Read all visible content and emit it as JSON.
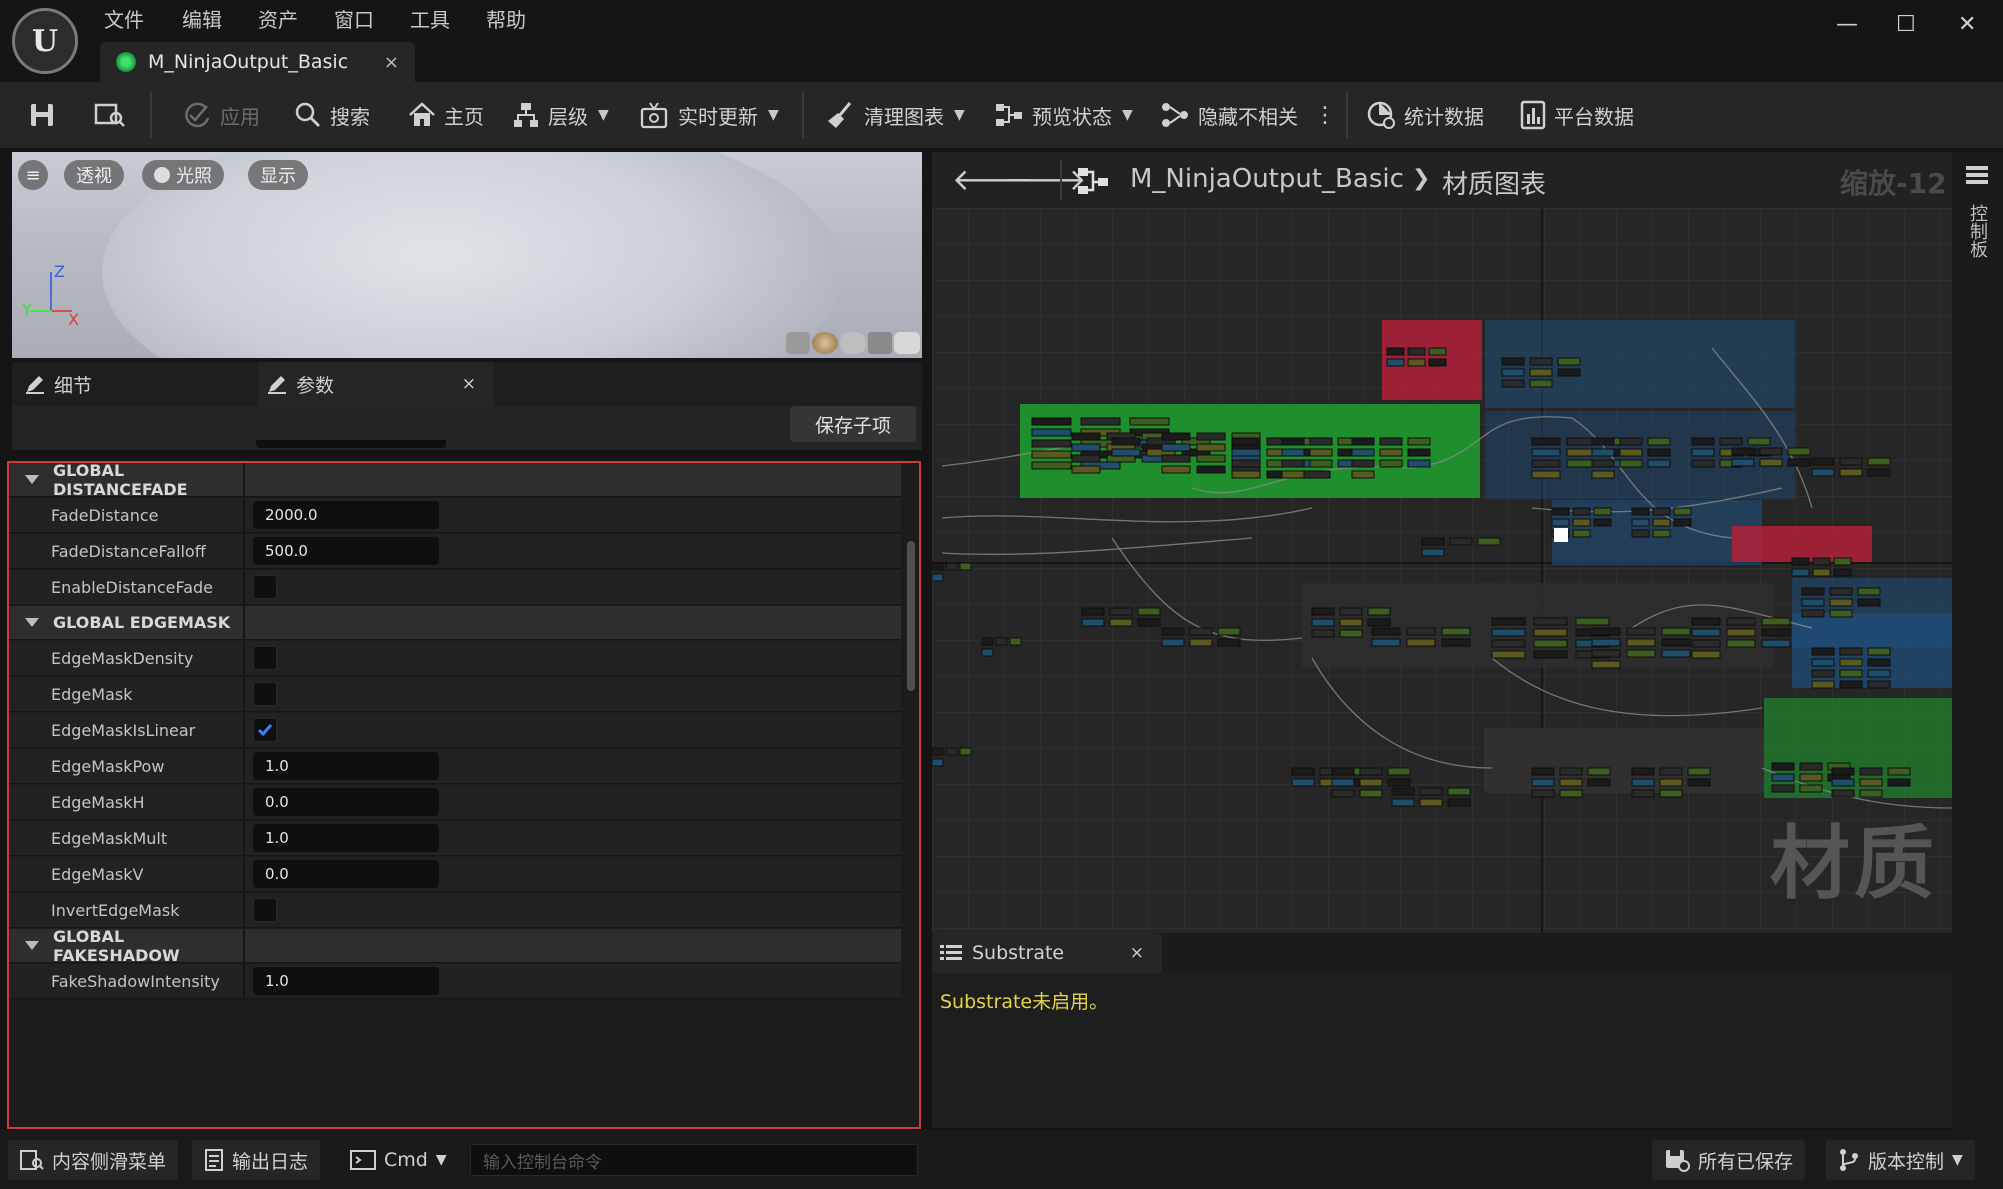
{
  "menu": [
    "文件",
    "编辑",
    "资产",
    "窗口",
    "工具",
    "帮助"
  ],
  "logo_text": "U",
  "doc_tab": {
    "title": "M_NinjaOutput_Basic",
    "close": "×"
  },
  "window_controls": {
    "minimize": "—",
    "maximize": "☐",
    "close": "✕"
  },
  "toolbar": {
    "apply": "应用",
    "search": "搜索",
    "home": "主页",
    "hierarchy": "层级",
    "live_update": "实时更新",
    "clean_graph": "清理图表",
    "preview_state": "预览状态",
    "hide_unrelated": "隐藏不相关",
    "stats": "统计数据",
    "platform_stats": "平台数据"
  },
  "viewport": {
    "perspective": "透视",
    "lit": "光照",
    "show": "显示",
    "axis_z": "Z",
    "axis_y": "Y",
    "axis_x": "X"
  },
  "panel_tabs": {
    "details": "细节",
    "params": "参数",
    "close": "×"
  },
  "save_child": "保存子项",
  "params": {
    "sections": [
      {
        "title": "GLOBAL DISTANCEFADE",
        "rows": [
          {
            "name": "FadeDistance",
            "type": "number",
            "value": "2000.0"
          },
          {
            "name": "FadeDistanceFalloff",
            "type": "number",
            "value": "500.0"
          },
          {
            "name": "EnableDistanceFade",
            "type": "bool",
            "value": false
          }
        ]
      },
      {
        "title": "GLOBAL EDGEMASK",
        "rows": [
          {
            "name": "EdgeMaskDensity",
            "type": "bool",
            "value": false
          },
          {
            "name": "EdgeMask",
            "type": "bool",
            "value": false
          },
          {
            "name": "EdgeMaskIsLinear",
            "type": "bool",
            "value": true
          },
          {
            "name": "EdgeMaskPow",
            "type": "number",
            "value": "1.0"
          },
          {
            "name": "EdgeMaskH",
            "type": "number",
            "value": "0.0"
          },
          {
            "name": "EdgeMaskMult",
            "type": "number",
            "value": "1.0"
          },
          {
            "name": "EdgeMaskV",
            "type": "number",
            "value": "0.0"
          },
          {
            "name": "InvertEdgeMask",
            "type": "bool",
            "value": false
          }
        ]
      },
      {
        "title": "GLOBAL FAKESHADOW",
        "rows": [
          {
            "name": "FakeShadowIntensity",
            "type": "number",
            "value": "1.0"
          }
        ]
      }
    ]
  },
  "graph": {
    "breadcrumb_asset": "M_NinjaOutput_Basic",
    "breadcrumb_sep": "❯",
    "breadcrumb_graph": "材质图表",
    "zoom": "缩放-12",
    "watermark": "材质",
    "side_tab": "控制板"
  },
  "substrate": {
    "tab": "Substrate",
    "close": "×",
    "message": "Substrate未启用。"
  },
  "statusbar": {
    "content_drawer": "内容侧滑菜单",
    "output_log": "输出日志",
    "cmd": "Cmd",
    "console_placeholder": "输入控制台命令",
    "all_saved": "所有已保存",
    "source_control": "版本控制"
  },
  "colors": {
    "accent_red": "#d23b3b",
    "node_green": "#1f8f2e",
    "node_red": "#b3213a",
    "node_blue": "#1f4e79",
    "check_blue": "#3b82f6",
    "substrate_msg": "#e5d44a"
  }
}
